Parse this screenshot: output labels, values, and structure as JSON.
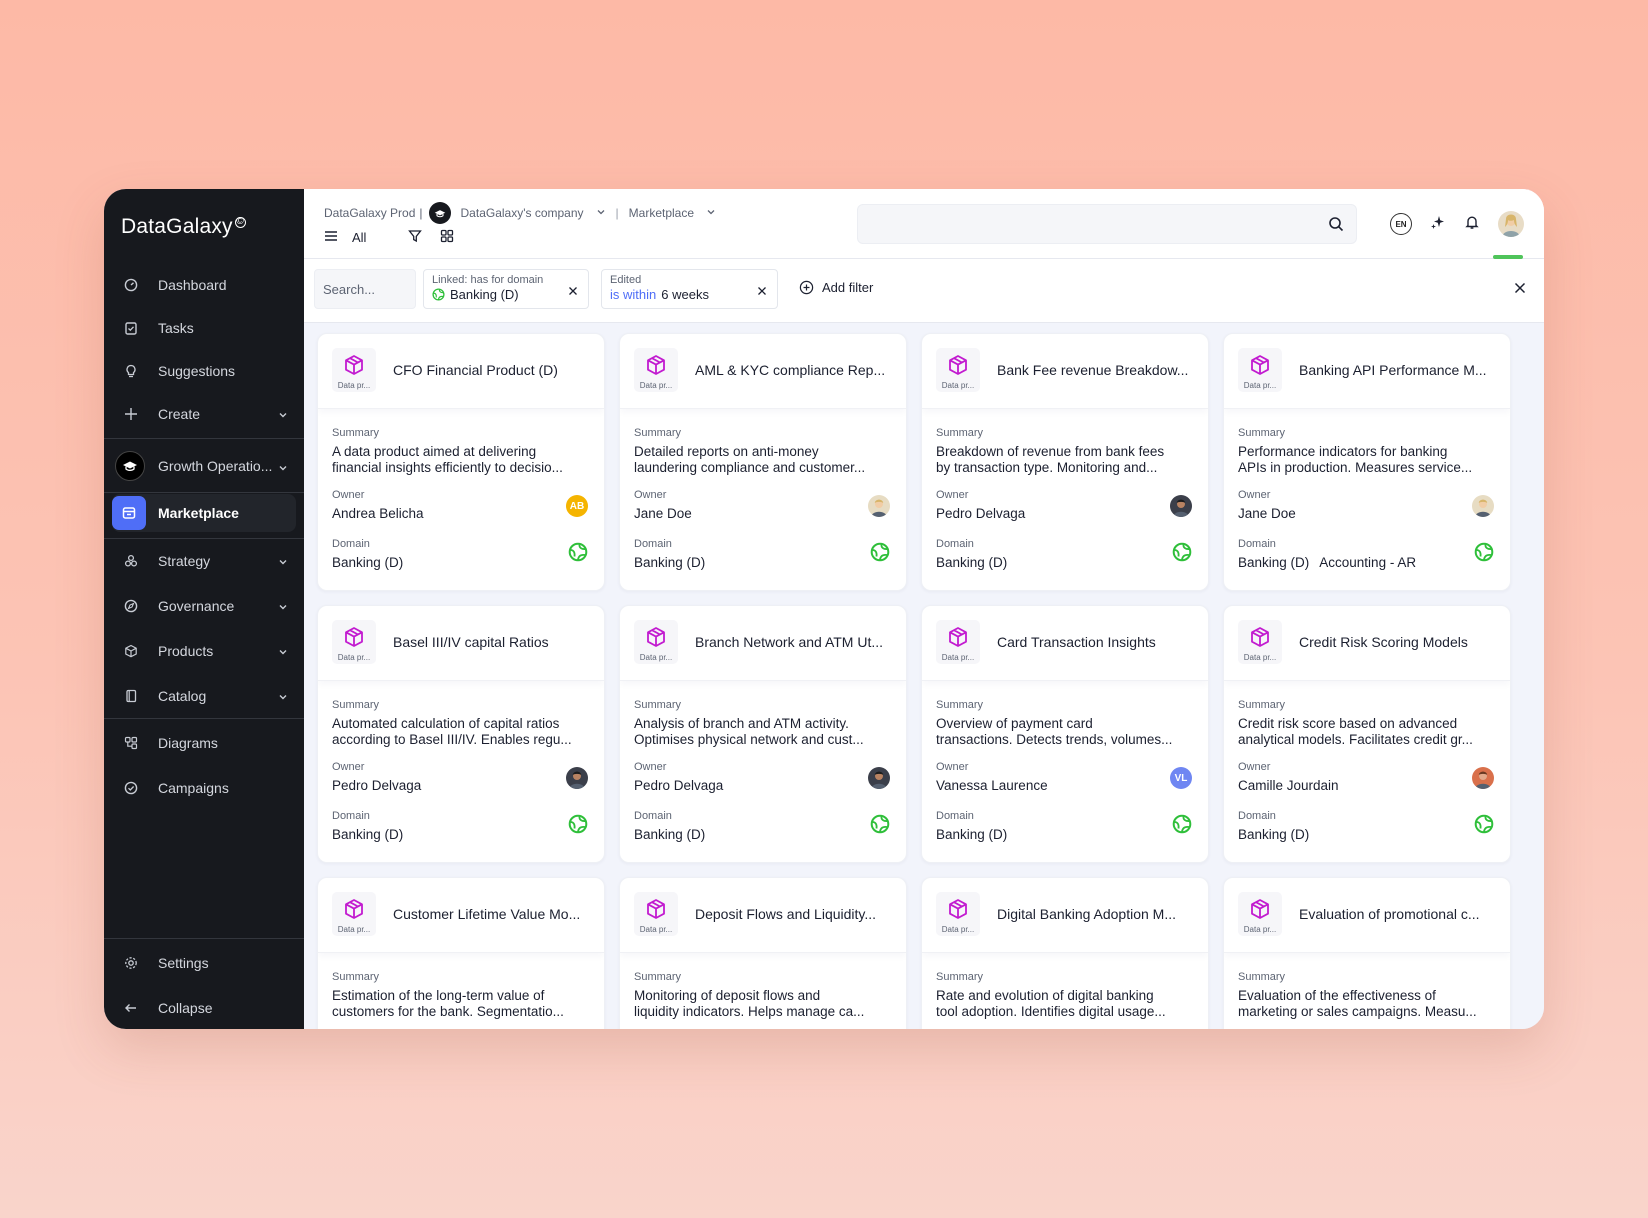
{
  "sidebar": {
    "logo": "DataGalaxy",
    "items": [
      {
        "label": "Dashboard",
        "icon": "dashboard-icon"
      },
      {
        "label": "Tasks",
        "icon": "tasks-icon"
      },
      {
        "label": "Suggestions",
        "icon": "lightbulb-icon"
      },
      {
        "label": "Create",
        "icon": "plus-icon"
      }
    ],
    "workspace": "Growth Operatio...",
    "marketplace": "Marketplace",
    "groups": [
      {
        "label": "Strategy",
        "icon": "strategy-icon"
      },
      {
        "label": "Governance",
        "icon": "governance-icon"
      },
      {
        "label": "Products",
        "icon": "products-icon"
      },
      {
        "label": "Catalog",
        "icon": "catalog-icon"
      }
    ],
    "tools": [
      {
        "label": "Diagrams",
        "icon": "diagrams-icon"
      },
      {
        "label": "Campaigns",
        "icon": "campaigns-icon"
      }
    ],
    "settings": "Settings",
    "collapse": "Collapse"
  },
  "header": {
    "crumb_org": "DataGalaxy Prod",
    "crumb_sep1": "|",
    "crumb_company": "DataGalaxy's company",
    "crumb_sep2": "|",
    "crumb_page": "Marketplace",
    "view_label": "All",
    "lang": "EN"
  },
  "filters": {
    "search_placeholder": "Search...",
    "chip1_label": "Linked: has for domain",
    "chip1_value": "Banking (D)",
    "chip2_label": "Edited",
    "chip2_op": "is within",
    "chip2_value": "6 weeks",
    "add_filter": "Add filter"
  },
  "labels": {
    "type_caption": "Data pr...",
    "summary": "Summary",
    "owner": "Owner",
    "domain": "Domain"
  },
  "colors": {
    "accent": "#4f6ef7",
    "product_icon": "#c21bd0",
    "domain_icon": "#2fbf3a",
    "sidebar_bg": "#17191e"
  },
  "cards": [
    {
      "title": "CFO Financial Product (D)",
      "summary": [
        "A data product aimed at delivering",
        "financial insights efficiently to decisio..."
      ],
      "owner": "Andrea Belicha",
      "avatar": {
        "initials": "AB",
        "color": "#f5b400"
      },
      "domains": [
        "Banking (D)"
      ]
    },
    {
      "title": "AML & KYC compliance Rep...",
      "summary": [
        "Detailed reports on anti-money",
        "laundering compliance and customer..."
      ],
      "owner": "Jane Doe",
      "avatar": {
        "initials": "",
        "color": "#e7dcc3"
      },
      "domains": [
        "Banking (D)"
      ]
    },
    {
      "title": "Bank Fee revenue Breakdow...",
      "summary": [
        "Breakdown of revenue from bank fees",
        "by transaction type. Monitoring and..."
      ],
      "owner": "Pedro Delvaga",
      "avatar": {
        "initials": "",
        "color": "#3b3f4a"
      },
      "domains": [
        "Banking (D)"
      ]
    },
    {
      "title": "Banking API Performance M...",
      "summary": [
        "Performance indicators for banking",
        "APIs in production. Measures service..."
      ],
      "owner": "Jane Doe",
      "avatar": {
        "initials": "",
        "color": "#e7dcc3"
      },
      "domains": [
        "Banking (D)",
        "Accounting - AR"
      ]
    },
    {
      "title": "Basel III/IV capital Ratios",
      "summary": [
        "Automated calculation of capital ratios",
        "according to Basel III/IV. Enables regu..."
      ],
      "owner": "Pedro Delvaga",
      "avatar": {
        "initials": "",
        "color": "#3b3f4a"
      },
      "domains": [
        "Banking (D)"
      ]
    },
    {
      "title": "Branch Network and ATM Ut...",
      "summary": [
        "Analysis of branch and ATM activity.",
        "Optimises physical network and cust..."
      ],
      "owner": "Pedro Delvaga",
      "avatar": {
        "initials": "",
        "color": "#3b3f4a"
      },
      "domains": [
        "Banking (D)"
      ]
    },
    {
      "title": "Card Transaction Insights",
      "summary": [
        "Overview of payment card",
        "transactions. Detects trends, volumes..."
      ],
      "owner": "Vanessa Laurence",
      "avatar": {
        "initials": "VL",
        "color": "#6f86f2"
      },
      "domains": [
        "Banking (D)"
      ]
    },
    {
      "title": "Credit Risk Scoring Models",
      "summary": [
        "Credit risk score based on advanced",
        "analytical models. Facilitates credit gr..."
      ],
      "owner": "Camille Jourdain",
      "avatar": {
        "initials": "",
        "color": "#d9704b"
      },
      "domains": [
        "Banking (D)"
      ]
    },
    {
      "title": "Customer Lifetime Value Mo...",
      "summary": [
        "Estimation of the long-term value of",
        "customers for the bank. Segmentatio..."
      ],
      "owner": "",
      "avatar": {
        "initials": "",
        "color": ""
      },
      "domains": []
    },
    {
      "title": "Deposit Flows and Liquidity...",
      "summary": [
        "Monitoring of deposit flows and",
        "liquidity indicators. Helps manage ca..."
      ],
      "owner": "",
      "avatar": {
        "initials": "",
        "color": ""
      },
      "domains": []
    },
    {
      "title": "Digital Banking Adoption M...",
      "summary": [
        "Rate and evolution of digital banking",
        "tool adoption. Identifies digital usage..."
      ],
      "owner": "",
      "avatar": {
        "initials": "",
        "color": ""
      },
      "domains": []
    },
    {
      "title": "Evaluation of promotional c...",
      "summary": [
        "Evaluation of the effectiveness of",
        "marketing or sales campaigns. Measu..."
      ],
      "owner": "",
      "avatar": {
        "initials": "",
        "color": ""
      },
      "domains": []
    }
  ]
}
